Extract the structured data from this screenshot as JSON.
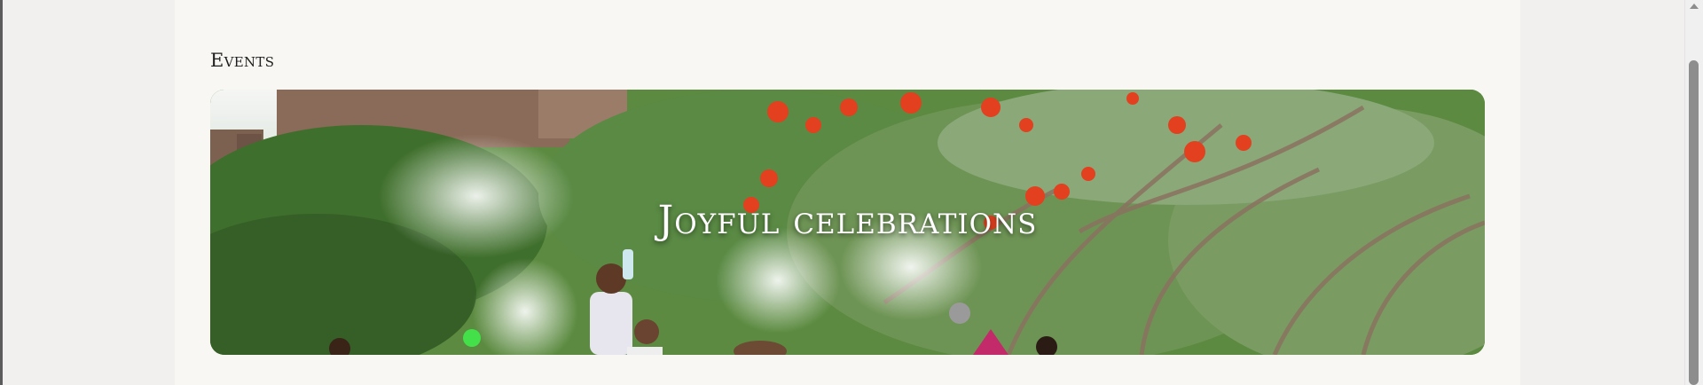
{
  "events": {
    "heading": "Events",
    "banner": {
      "title": "Joyful celebrations",
      "image": "water-festival-photo"
    }
  },
  "colors": {
    "page_background": "#efeeec",
    "card_background": "#f8f7f3",
    "heading_text": "#1e1e1e",
    "banner_text": "#ffffff"
  }
}
